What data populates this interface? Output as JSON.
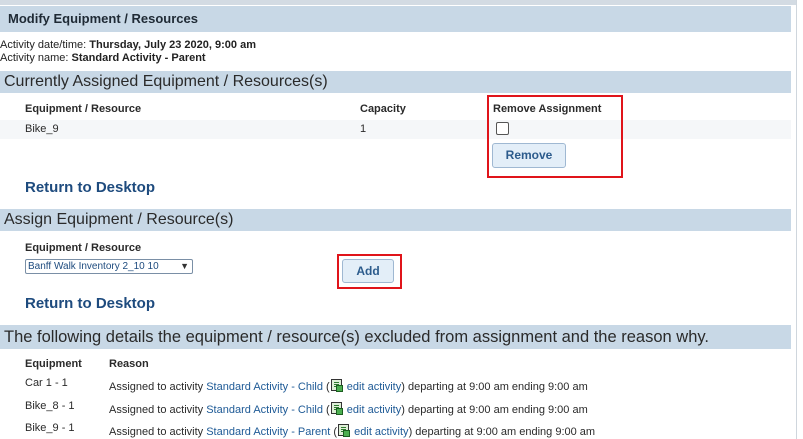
{
  "page": {
    "title": "Modify Equipment / Resources",
    "activity_datetime_label": "Activity date/time:",
    "activity_datetime_value": "Thursday, July 23 2020, 9:00 am",
    "activity_name_label": "Activity name:",
    "activity_name_value": "Standard Activity - Parent"
  },
  "assigned": {
    "section_title": "Currently Assigned Equipment / Resources(s)",
    "columns": [
      "Equipment / Resource",
      "Capacity",
      "Remove Assignment"
    ],
    "rows": [
      {
        "equipment": "Bike_9",
        "capacity": "1",
        "remove_checked": false
      }
    ],
    "remove_button": "Remove",
    "return_link": "Return to Desktop"
  },
  "assign": {
    "section_title": "Assign Equipment / Resource(s)",
    "field_label": "Equipment / Resource",
    "selected_option": "Banff Walk Inventory 2_10 10",
    "add_button": "Add",
    "return_link": "Return to Desktop"
  },
  "excluded": {
    "section_title": "The following details the equipment / resource(s) excluded from assignment and the reason why.",
    "columns": [
      "Equipment",
      "Reason"
    ],
    "rows": [
      {
        "equipment": "Car 1 - 1",
        "prefix": "Assigned to activity",
        "activity": "Standard Activity - Child",
        "edit": "edit activity",
        "suffix": "departing at 9:00 am ending 9:00 am"
      },
      {
        "equipment": "Bike_8 - 1",
        "prefix": "Assigned to activity",
        "activity": "Standard Activity - Child",
        "edit": "edit activity",
        "suffix": "departing at 9:00 am ending 9:00 am"
      },
      {
        "equipment": "Bike_9 - 1",
        "prefix": "Assigned to activity",
        "activity": "Standard Activity - Parent",
        "edit": "edit activity",
        "suffix": "departing at 9:00 am ending 9:00 am"
      }
    ]
  },
  "colors": {
    "banner": "#c8d8e6",
    "link": "#1e4b7e",
    "highlight": "#e0141a"
  }
}
